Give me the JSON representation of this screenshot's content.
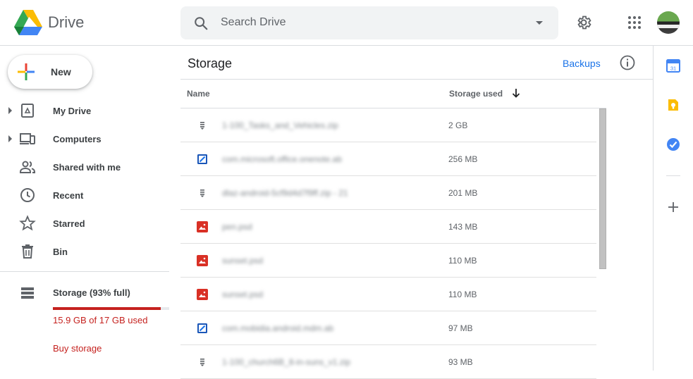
{
  "header": {
    "app_name": "Drive",
    "search_placeholder": "Search Drive",
    "icons": [
      "drive-logo",
      "search-icon",
      "search-options-icon",
      "settings-icon",
      "apps-icon",
      "avatar"
    ]
  },
  "sidebar": {
    "new_label": "New",
    "items": [
      {
        "label": "My Drive",
        "icon": "my-drive-icon",
        "expandable": true
      },
      {
        "label": "Computers",
        "icon": "computers-icon",
        "expandable": true
      },
      {
        "label": "Shared with me",
        "icon": "shared-icon",
        "expandable": false
      },
      {
        "label": "Recent",
        "icon": "clock-icon",
        "expandable": false
      },
      {
        "label": "Starred",
        "icon": "star-icon",
        "expandable": false
      },
      {
        "label": "Bin",
        "icon": "trash-icon",
        "expandable": false
      }
    ],
    "storage": {
      "title": "Storage (93% full)",
      "used_text": "15.9 GB of 17 GB used",
      "fraction_used": 0.93,
      "buy_label": "Buy storage",
      "bar_color": "#c5221f"
    }
  },
  "main": {
    "title": "Storage",
    "backups_label": "Backups",
    "columns": {
      "name": "Name",
      "storage": "Storage used"
    },
    "sort": "storage-descending",
    "rows": [
      {
        "name": "1-100_Tasks_and_Vehicles.zip",
        "size": "2 GB",
        "icon": "archive"
      },
      {
        "name": "com.microsoft.office.onenote.ab",
        "size": "256 MB",
        "icon": "backup"
      },
      {
        "name": "dlaz-android-5cf9d4d7f9ff.zip - 21",
        "size": "201 MB",
        "icon": "archive"
      },
      {
        "name": "pen.psd",
        "size": "143 MB",
        "icon": "image"
      },
      {
        "name": "sunset.psd",
        "size": "110 MB",
        "icon": "image"
      },
      {
        "name": "sunset.psd",
        "size": "110 MB",
        "icon": "image"
      },
      {
        "name": "com.mobidia.android.mdm.ab",
        "size": "97 MB",
        "icon": "backup"
      },
      {
        "name": "1-100_church6B_8-in-suns_v1.zip",
        "size": "93 MB",
        "icon": "archive"
      }
    ]
  },
  "right_rail": {
    "icons": [
      "calendar-icon",
      "keep-icon",
      "tasks-icon",
      "add-icon"
    ],
    "calendar_day": "31"
  },
  "colors": {
    "accent": "#1a73e8",
    "warning": "#c5221f",
    "search_bg": "#f1f3f4"
  }
}
